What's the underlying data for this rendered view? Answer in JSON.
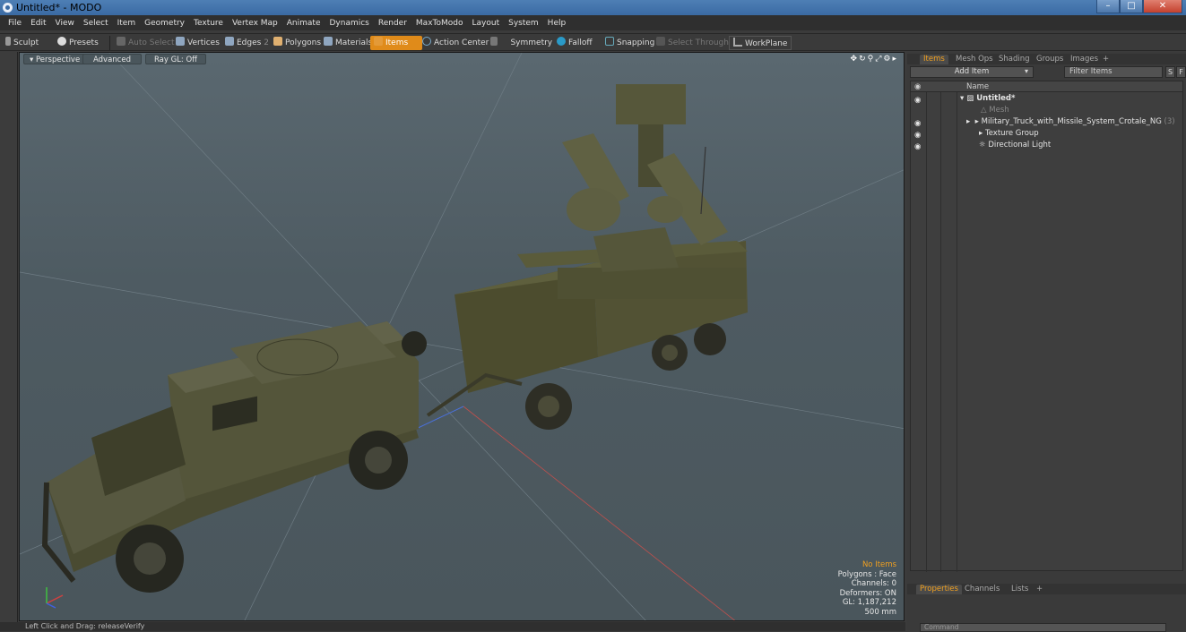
{
  "window": {
    "title": "Untitled* - MODO"
  },
  "menu": [
    "File",
    "Edit",
    "View",
    "Select",
    "Item",
    "Geometry",
    "Texture",
    "Vertex Map",
    "Animate",
    "Dynamics",
    "Render",
    "MaxToModo",
    "Layout",
    "System",
    "Help"
  ],
  "toolbar": {
    "sculpt": "Sculpt",
    "presets": "Presets",
    "auto_select": "Auto Select",
    "vertices": "Vertices",
    "edges": "Edges",
    "edges_count": "2",
    "polygons": "Polygons",
    "materials": "Materials",
    "items": "Items",
    "action_center": "Action Center",
    "symmetry": "Symmetry",
    "falloff": "Falloff",
    "snapping": "Snapping",
    "select_through": "Select Through",
    "workplane": "WorkPlane"
  },
  "viewport": {
    "perspective": "Perspective",
    "advanced": "Advanced",
    "raygl": "Ray GL: Off",
    "stats": {
      "items": "No Items",
      "polygons": "Polygons : Face",
      "channels": "Channels: 0",
      "deformers": "Deformers: ON",
      "gl": "GL: 1,187,212",
      "size": "500 mm"
    }
  },
  "status": {
    "text": "Left Click and Drag:  releaseVerify"
  },
  "panel": {
    "tabs": [
      "Items",
      "Mesh Ops",
      "Shading",
      "Groups",
      "Images"
    ],
    "add_item": "Add Item",
    "filter": "Filter Items",
    "s": "S",
    "f": "F",
    "name_header": "Name",
    "tree": [
      {
        "label": "Untitled*"
      },
      {
        "label": "Mesh"
      },
      {
        "label": "Military_Truck_with_Missile_System_Crotale_NG",
        "count": "(3)"
      },
      {
        "label": "Texture Group"
      },
      {
        "label": "Directional Light"
      }
    ],
    "bottom_tabs": [
      "Properties",
      "Channels",
      "Lists"
    ],
    "command_placeholder": "Command"
  },
  "colors": {
    "accent": "#e08b1a",
    "viewport_bg": "#55626a",
    "vehicle": "#4b4d33"
  }
}
